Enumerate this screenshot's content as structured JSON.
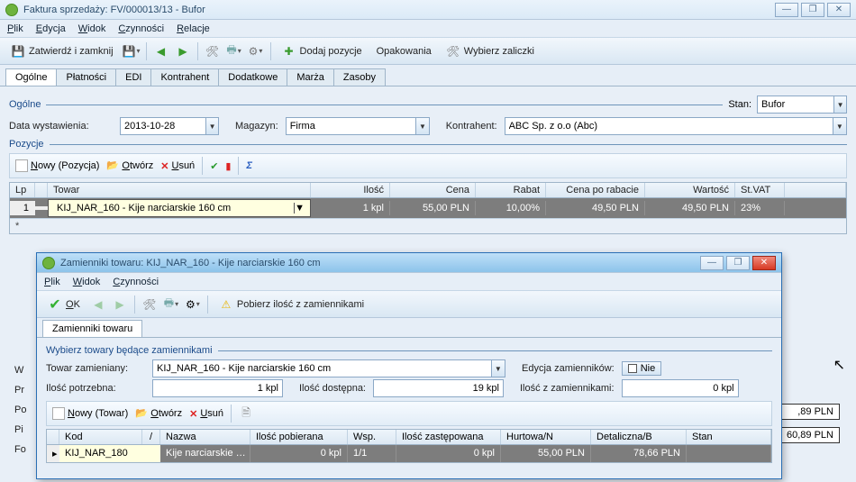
{
  "window": {
    "title": "Faktura sprzedaży: FV/000013/13 - Bufor",
    "min": "—",
    "max": "❐",
    "close": "✕"
  },
  "menu": [
    "Plik",
    "Edycja",
    "Widok",
    "Czynności",
    "Relacje"
  ],
  "toolbar": {
    "confirm": "Zatwierdź i zamknij",
    "addpos": "Dodaj pozycje",
    "opak": "Opakowania",
    "zalicz": "Wybierz zaliczki"
  },
  "tabs": [
    "Ogólne",
    "Płatności",
    "EDI",
    "Kontrahent",
    "Dodatkowe",
    "Marża",
    "Zasoby"
  ],
  "general": {
    "group": "Ogólne",
    "stanLabel": "Stan:",
    "stanValue": "Bufor",
    "dateLabel": "Data wystawienia:",
    "dateValue": "2013-10-28",
    "magLabel": "Magazyn:",
    "magValue": "Firma",
    "konLabel": "Kontrahent:",
    "konValue": "ABC Sp. z o.o (Abc)"
  },
  "pozycje": {
    "group": "Pozycje",
    "new": "Nowy (Pozycja)",
    "open": "Otwórz",
    "del": "Usuń",
    "headers": {
      "lp": "Lp",
      "towar": "Towar",
      "ilosc": "Ilość",
      "cena": "Cena",
      "rabat": "Rabat",
      "cpr": "Cena po rabacie",
      "wartosc": "Wartość",
      "stvat": "St.VAT"
    },
    "row": {
      "lp": "1",
      "towar": "KIJ_NAR_160 - Kije narciarskie 160 cm",
      "ilosc": "1 kpl",
      "cena": "55,00 PLN",
      "rabat": "10,00%",
      "cpr": "49,50 PLN",
      "wartosc": "49,50 PLN",
      "stvat": "23%"
    }
  },
  "sidelabels": {
    "w": "W",
    "pr": "Pr",
    "po": "Po",
    "pi": "Pi",
    "fo": "Fo"
  },
  "summary": {
    "v1": ",89 PLN",
    "v2": "60,89 PLN"
  },
  "dlg": {
    "title": "Zamienniki towaru: KIJ_NAR_160 - Kije narciarskie 160 cm",
    "menu": [
      "Plik",
      "Widok",
      "Czynności"
    ],
    "ok": "OK",
    "pobierz": "Pobierz ilość z zamiennikami",
    "tab": "Zamienniki towaru",
    "group": "Wybierz towary będące zamiennikami",
    "towarLabel": "Towar zamieniany:",
    "towarValue": "KIJ_NAR_160 - Kije narciarskie 160 cm",
    "edycjaLabel": "Edycja zamienników:",
    "nie": "Nie",
    "iloscPotLabel": "Ilość potrzebna:",
    "iloscPotValue": "1 kpl",
    "iloscDostLabel": "Ilość dostępna:",
    "iloscDostValue": "19 kpl",
    "iloscZamLabel": "Ilość z zamiennikami:",
    "iloscZamValue": "0 kpl",
    "new": "Nowy (Towar)",
    "open": "Otwórz",
    "del": "Usuń",
    "headers": {
      "kod": "Kod",
      "slash": "/",
      "nazwa": "Nazwa",
      "ipob": "Ilość pobierana",
      "wsp": "Wsp.",
      "izast": "Ilość zastępowana",
      "hurt": "Hurtowa/N",
      "detal": "Detaliczna/B",
      "stan": "Stan"
    },
    "row": {
      "kod": "KIJ_NAR_180",
      "nazwa": "Kije narciarskie …",
      "ipob": "0 kpl",
      "wsp": "1/1",
      "izast": "0 kpl",
      "hurt": "55,00 PLN",
      "detal": "78,66 PLN",
      "stan": ""
    }
  }
}
